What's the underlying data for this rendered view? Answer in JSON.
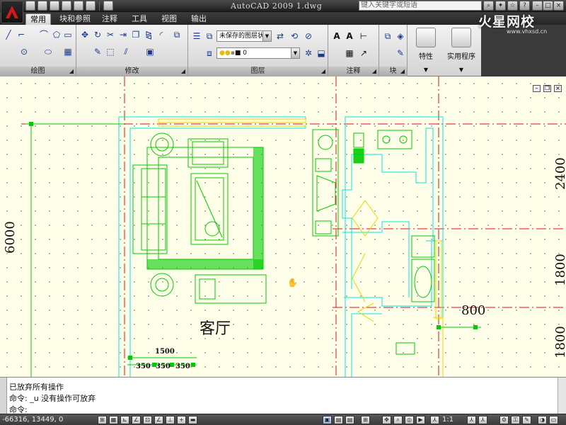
{
  "titlebar": {
    "window_title": "AutoCAD 2009  1.dwg",
    "search_placeholder": "键入关键字或短语",
    "brand": "火星网校",
    "brand_url": "www.vhxsd.cn"
  },
  "tabs": [
    "常用",
    "块和参照",
    "注释",
    "工具",
    "视图",
    "输出"
  ],
  "ribbon": {
    "panels": [
      "绘图",
      "修改",
      "图层",
      "注释",
      "块"
    ],
    "layer_state": "未保存的图层状态",
    "current_layer": "0",
    "big_buttons": {
      "properties": "特性",
      "utilities": "实用程序"
    }
  },
  "drawing": {
    "room_label": "客厅",
    "dimensions": {
      "left_vertical": "6000",
      "right_top": "2400",
      "right_mid": "1800",
      "right_bottom": "1800",
      "door_width": "800",
      "bottom_total": "1500",
      "bottom_seg": [
        "350",
        "350",
        "350"
      ]
    }
  },
  "command": {
    "lines": [
      "已放弃所有操作",
      "命令: _u 没有操作可放弃"
    ],
    "prompt": "命令:"
  },
  "status": {
    "coords": "-66316, 13449, 0",
    "scale": "1:1"
  },
  "colors": {
    "background": "#fffee8",
    "wall": "#00e5e5",
    "axis": "#e01010",
    "furniture": "#00cc00",
    "window": "#e8d800"
  }
}
